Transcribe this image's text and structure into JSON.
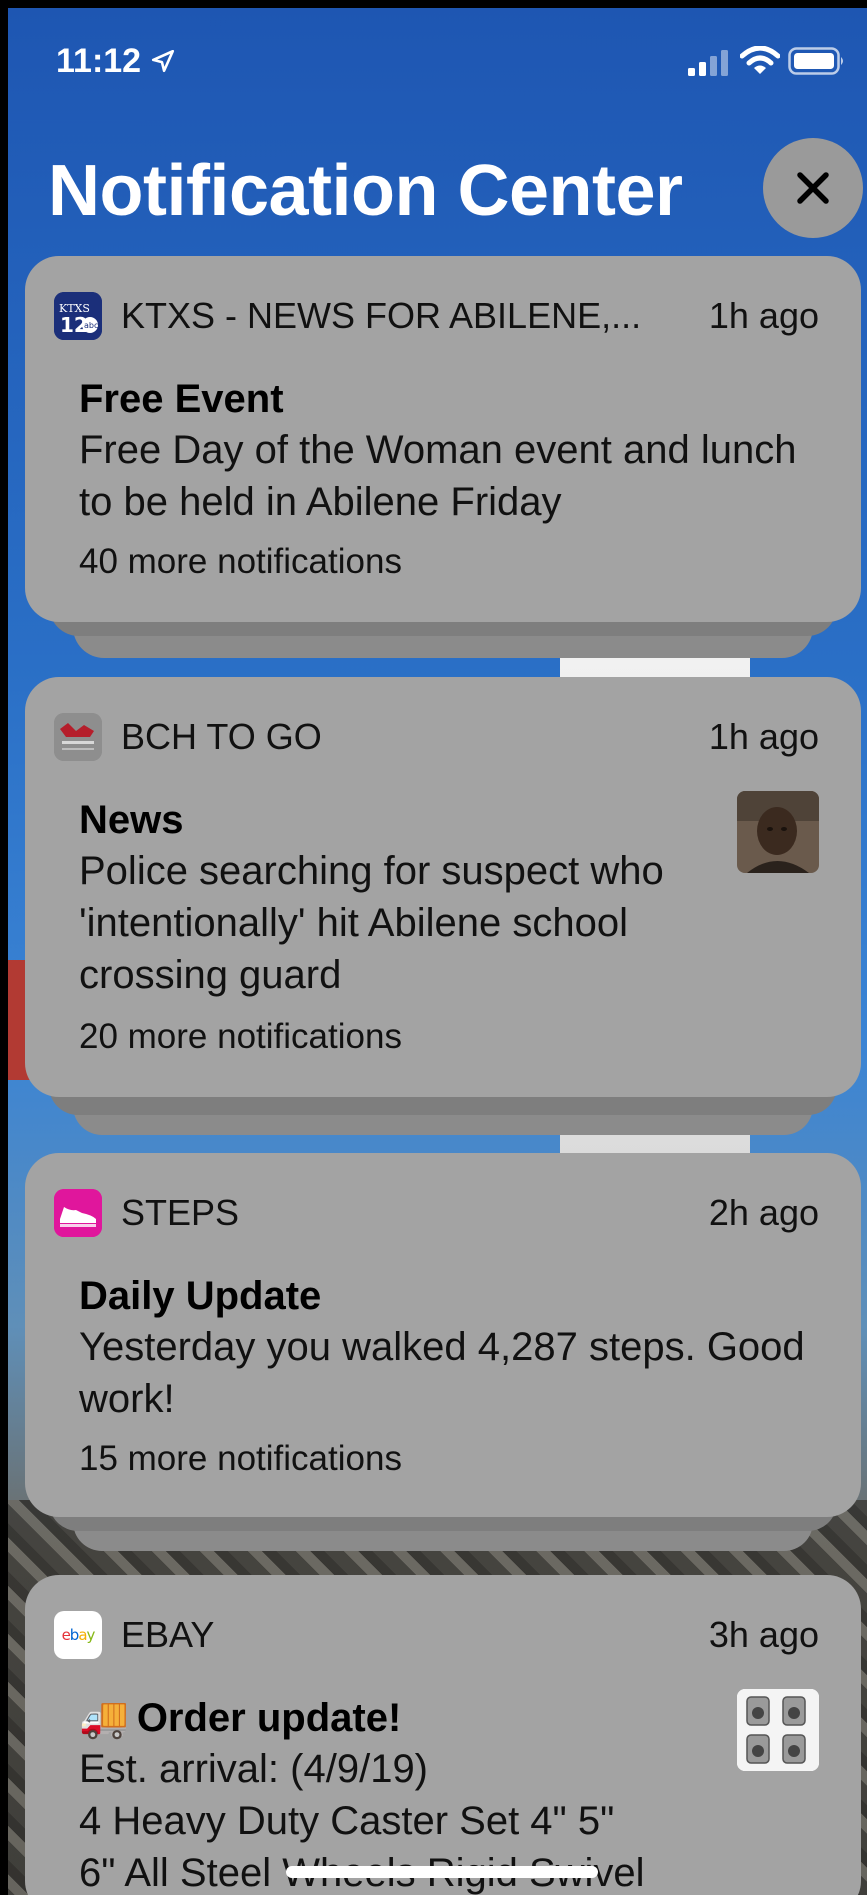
{
  "status_bar": {
    "time": "11:12",
    "location_icon": "location-arrow-icon",
    "signal_icon": "cellular-signal-icon",
    "wifi_icon": "wifi-icon",
    "battery_icon": "battery-icon"
  },
  "header": {
    "title": "Notification Center",
    "close_icon": "close-icon"
  },
  "notifications": [
    {
      "app": "KTXS - NEWS FOR ABILENE,...",
      "time": "1h ago",
      "title": "Free Event",
      "body": "Free Day of the Woman event and lunch to be held in Abilene Friday",
      "more": "40 more notifications",
      "icon": "ktxs-abc-icon"
    },
    {
      "app": "BCH TO GO",
      "time": "1h ago",
      "title": "News",
      "body": "Police searching for suspect who 'intentionally' hit Abilene school crossing guard",
      "more": "20 more notifications",
      "icon": "bch-to-go-icon",
      "thumbnail": "suspect-photo"
    },
    {
      "app": "STEPS",
      "time": "2h ago",
      "title": "Daily Update",
      "body": "Yesterday you walked 4,287 steps. Good work!",
      "more": "15 more notifications",
      "icon": "shoe-icon"
    },
    {
      "app": "EBAY",
      "time": "3h ago",
      "title": "Order update!",
      "title_emoji": "🚚",
      "body_line1": "Est. arrival: (4/9/19)",
      "body_line2": "4 Heavy Duty Caster Set 4\" 5\"",
      "body_line3": "6\" All Steel Wheels Rigid Swivel",
      "icon": "ebay-logo",
      "ebay_letters": [
        "e",
        "b",
        "a",
        "y"
      ],
      "thumbnail": "caster-wheels-photo"
    }
  ],
  "colors": {
    "card": "#a3a3a3",
    "steps_icon": "#e0169c",
    "ebay_e": "#e53238",
    "ebay_b": "#0064d2",
    "ebay_a": "#f5af02",
    "ebay_y": "#86b817"
  }
}
